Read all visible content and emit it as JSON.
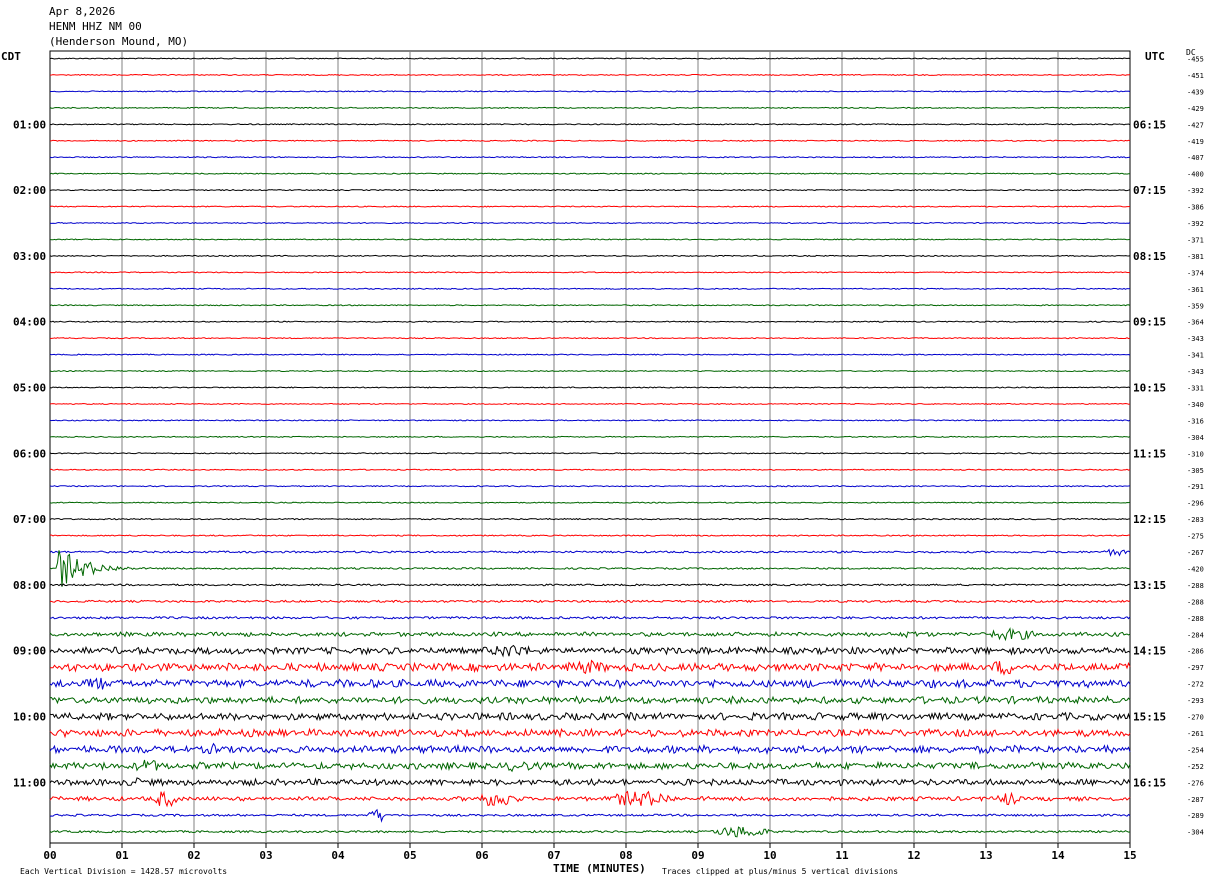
{
  "header": {
    "date": "Apr 8,2026",
    "station": "HENM HHZ NM 00",
    "location": "(Henderson Mound, MO)"
  },
  "labels": {
    "left_zone": "CDT",
    "right_zone": "UTC",
    "dc_label": "DC",
    "x_axis_title": "TIME (MINUTES)",
    "footer_left": "Each Vertical Division = 1428.57 microvolts",
    "footer_right": "Traces clipped at plus/minus 5 vertical divisions"
  },
  "colors": {
    "trace_cycle": [
      "#000000",
      "#ff0000",
      "#0000cc",
      "#006600"
    ],
    "grid": "#808080"
  },
  "chart_data": {
    "type": "line",
    "xlabel": "TIME (MINUTES)",
    "x_ticks": [
      "00",
      "01",
      "02",
      "03",
      "04",
      "05",
      "06",
      "07",
      "08",
      "09",
      "10",
      "11",
      "12",
      "13",
      "14",
      "15"
    ],
    "xlim": [
      0,
      15
    ],
    "left_time_labels": [
      {
        "row": 4,
        "text": "01:00"
      },
      {
        "row": 8,
        "text": "02:00"
      },
      {
        "row": 12,
        "text": "03:00"
      },
      {
        "row": 16,
        "text": "04:00"
      },
      {
        "row": 20,
        "text": "05:00"
      },
      {
        "row": 24,
        "text": "06:00"
      },
      {
        "row": 28,
        "text": "07:00"
      },
      {
        "row": 32,
        "text": "08:00"
      },
      {
        "row": 36,
        "text": "09:00"
      },
      {
        "row": 40,
        "text": "10:00"
      },
      {
        "row": 44,
        "text": "11:00"
      }
    ],
    "right_time_labels": [
      {
        "row": 4,
        "text": "06:15"
      },
      {
        "row": 8,
        "text": "07:15"
      },
      {
        "row": 12,
        "text": "08:15"
      },
      {
        "row": 16,
        "text": "09:15"
      },
      {
        "row": 20,
        "text": "10:15"
      },
      {
        "row": 24,
        "text": "11:15"
      },
      {
        "row": 28,
        "text": "12:15"
      },
      {
        "row": 32,
        "text": "13:15"
      },
      {
        "row": 36,
        "text": "14:15"
      },
      {
        "row": 40,
        "text": "15:15"
      },
      {
        "row": 44,
        "text": "16:15"
      }
    ],
    "dc_offsets": [
      "-455",
      "-451",
      "-439",
      "-429",
      "-427",
      "-419",
      "-407",
      "-400",
      "-392",
      "-386",
      "-392",
      "-371",
      "-381",
      "-374",
      "-361",
      "-359",
      "-364",
      "-343",
      "-341",
      "-343",
      "-331",
      "-340",
      "-316",
      "-304",
      "-310",
      "-305",
      "-291",
      "-296",
      "-283",
      "-275",
      "-267",
      "-420",
      "-288",
      "-288",
      "-288",
      "-284",
      "-286",
      "-297",
      "-272",
      "-293",
      "-270",
      "-261",
      "-254",
      "-252",
      "-276",
      "-287",
      "-289",
      "-304"
    ],
    "trace_count": 48,
    "row_activity": [
      0.5,
      0.5,
      0.5,
      0.5,
      0.5,
      0.5,
      0.5,
      0.5,
      0.5,
      0.5,
      0.5,
      0.5,
      0.5,
      0.5,
      0.5,
      0.5,
      0.5,
      0.5,
      0.5,
      0.5,
      0.5,
      0.5,
      0.5,
      0.5,
      0.5,
      0.5,
      0.5,
      0.5,
      0.6,
      0.6,
      0.9,
      0.8,
      0.8,
      1.0,
      1.1,
      1.6,
      2.6,
      3.0,
      3.0,
      2.6,
      2.8,
      2.8,
      2.8,
      2.6,
      2.4,
      1.6,
      1.0,
      1.0
    ],
    "events": [
      {
        "row": 31,
        "start_min": 0.1,
        "end_min": 1.3,
        "amplitude": 22
      },
      {
        "row": 30,
        "start_min": 14.6,
        "end_min": 15.0,
        "amplitude": 4
      },
      {
        "row": 35,
        "start_min": 12.9,
        "end_min": 13.8,
        "amplitude": 6
      },
      {
        "row": 35,
        "start_min": 11.8,
        "end_min": 12.1,
        "amplitude": 4
      },
      {
        "row": 36,
        "start_min": 6.0,
        "end_min": 6.8,
        "amplitude": 7
      },
      {
        "row": 37,
        "start_min": 13.0,
        "end_min": 13.5,
        "amplitude": 8
      },
      {
        "row": 37,
        "start_min": 7.0,
        "end_min": 7.9,
        "amplitude": 7
      },
      {
        "row": 38,
        "start_min": 0.4,
        "end_min": 0.9,
        "amplitude": 7
      },
      {
        "row": 42,
        "start_min": 2.1,
        "end_min": 2.5,
        "amplitude": 6
      },
      {
        "row": 43,
        "start_min": 1.1,
        "end_min": 1.6,
        "amplitude": 7
      },
      {
        "row": 43,
        "start_min": 6.2,
        "end_min": 6.8,
        "amplitude": 6
      },
      {
        "row": 44,
        "start_min": 1.1,
        "end_min": 1.3,
        "amplitude": 7
      },
      {
        "row": 45,
        "start_min": 1.4,
        "end_min": 1.8,
        "amplitude": 9
      },
      {
        "row": 45,
        "start_min": 5.8,
        "end_min": 6.6,
        "amplitude": 8
      },
      {
        "row": 45,
        "start_min": 7.6,
        "end_min": 8.8,
        "amplitude": 8
      },
      {
        "row": 45,
        "start_min": 13.1,
        "end_min": 13.5,
        "amplitude": 7
      },
      {
        "row": 46,
        "start_min": 4.4,
        "end_min": 4.7,
        "amplitude": 7
      },
      {
        "row": 47,
        "start_min": 9.1,
        "end_min": 10.1,
        "amplitude": 6
      }
    ]
  }
}
